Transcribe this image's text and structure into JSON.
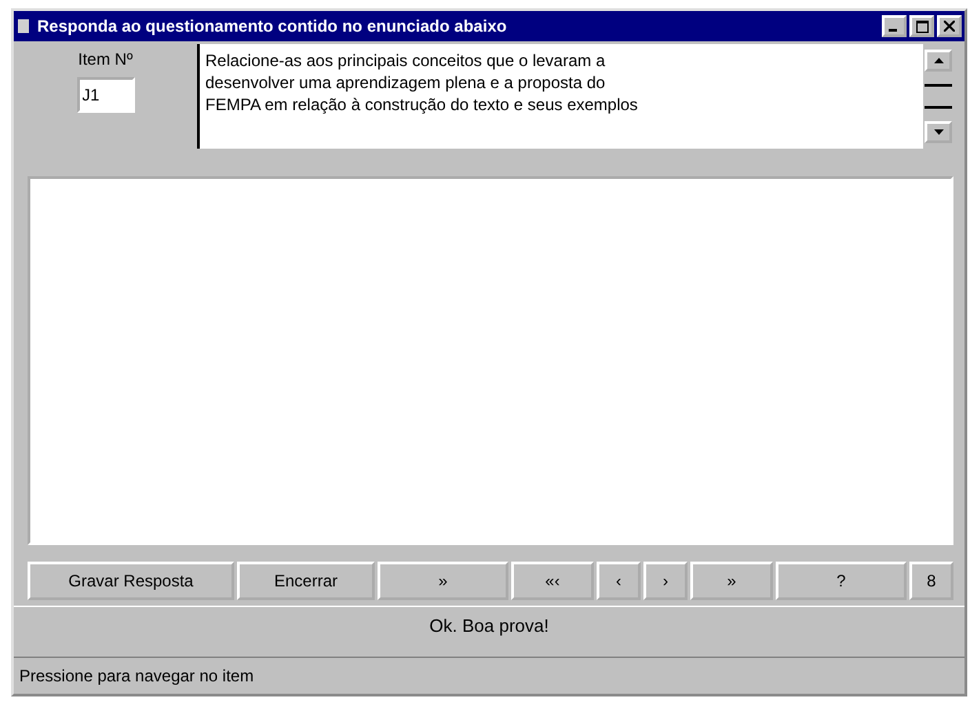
{
  "window": {
    "title": "Responda ao questionamento contido no enunciado abaixo"
  },
  "item": {
    "label": "Item Nº",
    "value": "J1"
  },
  "question": {
    "lines": [
      "Relacione-as aos principais conceitos que o levaram a",
      "desenvolver uma aprendizagem plena e a proposta do",
      "FEMPA em relação à construção do texto e seus exemplos"
    ]
  },
  "buttons": [
    {
      "label": "Gravar Resposta"
    },
    {
      "label": "Encerrar"
    },
    {
      "label": "»"
    },
    {
      "label": "«‹"
    },
    {
      "label": "‹"
    },
    {
      "label": "›"
    },
    {
      "label": "»"
    },
    {
      "label": "?"
    },
    {
      "label": "8"
    }
  ],
  "message": "Ok. Boa prova!",
  "status_bar": "Pressione para navegar no item"
}
